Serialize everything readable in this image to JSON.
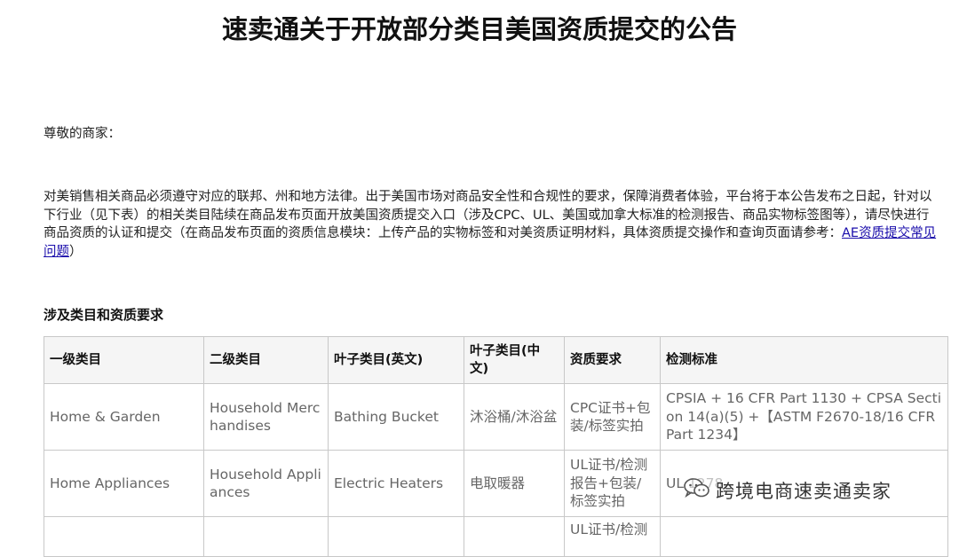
{
  "title": "速卖通关于开放部分类目美国资质提交的公告",
  "greeting": "尊敬的商家：",
  "body_text": "对美销售相关商品必须遵守对应的联邦、州和地方法律。出于美国市场对商品安全性和合规性的要求，保障消费者体验，平台将于本公告发布之日起，针对以下行业（见下表）的相关类目陆续在商品发布页面开放美国资质提交入口（涉及CPC、UL、美国或加拿大标准的检测报告、商品实物标签图等），请尽快进行商品资质的认证和提交（在商品发布页面的资质信息模块：上传产品的实物标签和对美资质证明材料，具体资质提交操作和查询页面请参考：",
  "link_text": "AE资质提交常见问题",
  "body_text_end": "）",
  "section_heading": "涉及类目和资质要求",
  "table": {
    "headers": [
      "一级类目",
      "二级类目",
      "叶子类目(英文)",
      "叶子类目(中文)",
      "资质要求",
      "检测标准"
    ],
    "rows": [
      [
        "Home & Garden",
        "Household Merchandises",
        "Bathing Bucket",
        "沐浴桶/沐浴盆",
        "CPC证书+包装/标签实拍",
        "CPSIA + 16 CFR Part 1130 + CPSA Section 14(a)(5) +【ASTM F2670-18/16 CFR Part 1234】"
      ],
      [
        "Home Appliances",
        "Household Appliances",
        "Electric Heaters",
        "电取暖器",
        "UL证书/检测报告+包装/标签实拍",
        "UL 1278"
      ],
      [
        "",
        "",
        "",
        "",
        "UL证书/检测",
        ""
      ]
    ]
  },
  "watermark": {
    "text": "跨境电商速卖通卖家",
    "icon": "wechat-icon"
  }
}
